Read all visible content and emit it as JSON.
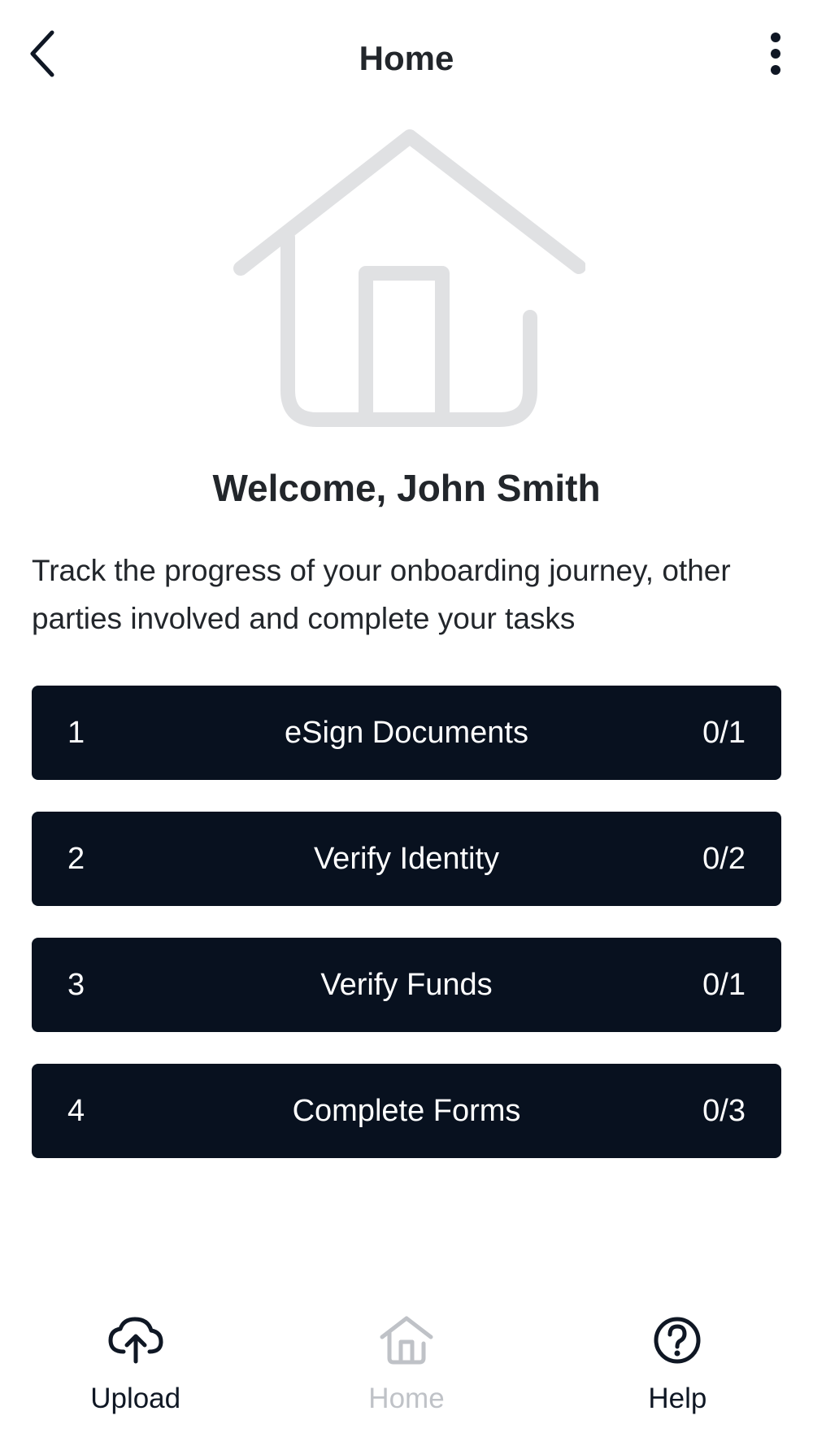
{
  "header": {
    "title": "Home",
    "back_icon": "chevron-left-icon",
    "more_icon": "more-vertical-icon"
  },
  "hero": {
    "icon": "house-illustration"
  },
  "welcome": "Welcome, John Smith",
  "description": "Track the progress of your onboarding journey, other parties involved and complete your tasks",
  "tasks": [
    {
      "number": "1",
      "label": "eSign Documents",
      "count": "0/1"
    },
    {
      "number": "2",
      "label": "Verify Identity",
      "count": "0/2"
    },
    {
      "number": "3",
      "label": "Verify Funds",
      "count": "0/1"
    },
    {
      "number": "4",
      "label": "Complete Forms",
      "count": "0/3"
    }
  ],
  "bottom_nav": [
    {
      "label": "Upload",
      "icon": "cloud-upload-icon",
      "active": false
    },
    {
      "label": "Home",
      "icon": "home-icon",
      "active": true
    },
    {
      "label": "Help",
      "icon": "help-circle-icon",
      "active": false
    }
  ],
  "colors": {
    "task_bg": "#08111f",
    "text": "#22262b",
    "inactive": "#bfc2c7",
    "illustration": "#e0e1e3"
  }
}
